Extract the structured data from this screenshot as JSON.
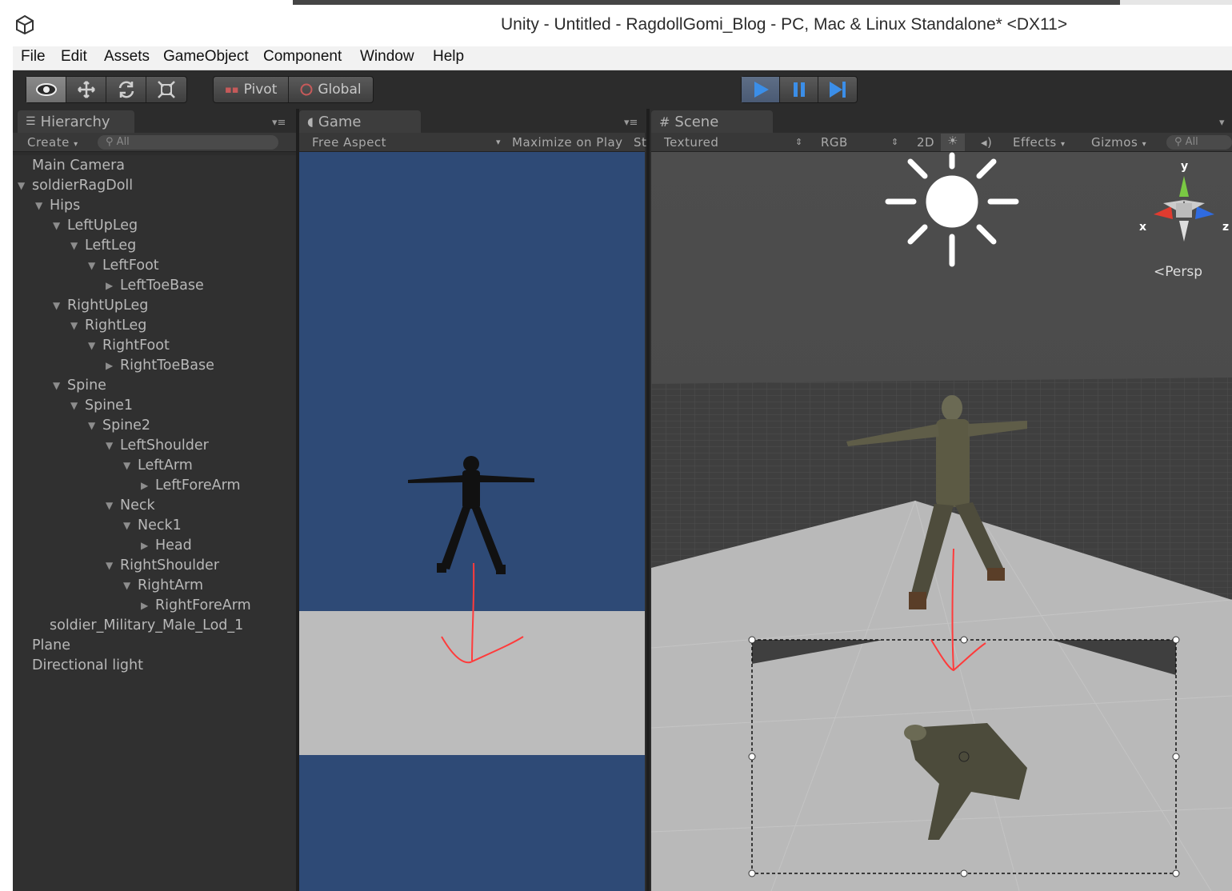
{
  "window": {
    "title": "Unity - Untitled - RagdollGomi_Blog - PC, Mac & Linux Standalone* <DX11>"
  },
  "menu": {
    "items": [
      "File",
      "Edit",
      "Assets",
      "GameObject",
      "Component",
      "Window",
      "Help"
    ]
  },
  "toolbar": {
    "pivot_label": "Pivot",
    "global_label": "Global"
  },
  "hierarchy": {
    "tab_label": "Hierarchy",
    "create_label": "Create",
    "search_placeholder": "All",
    "items": [
      {
        "label": "Main Camera",
        "depth": 0,
        "expander": "none"
      },
      {
        "label": "soldierRagDoll",
        "depth": 0,
        "expander": "open"
      },
      {
        "label": "Hips",
        "depth": 1,
        "expander": "open"
      },
      {
        "label": "LeftUpLeg",
        "depth": 2,
        "expander": "open"
      },
      {
        "label": "LeftLeg",
        "depth": 3,
        "expander": "open"
      },
      {
        "label": "LeftFoot",
        "depth": 4,
        "expander": "open"
      },
      {
        "label": "LeftToeBase",
        "depth": 5,
        "expander": "closed"
      },
      {
        "label": "RightUpLeg",
        "depth": 2,
        "expander": "open"
      },
      {
        "label": "RightLeg",
        "depth": 3,
        "expander": "open"
      },
      {
        "label": "RightFoot",
        "depth": 4,
        "expander": "open"
      },
      {
        "label": "RightToeBase",
        "depth": 5,
        "expander": "closed"
      },
      {
        "label": "Spine",
        "depth": 2,
        "expander": "open"
      },
      {
        "label": "Spine1",
        "depth": 3,
        "expander": "open"
      },
      {
        "label": "Spine2",
        "depth": 4,
        "expander": "open"
      },
      {
        "label": "LeftShoulder",
        "depth": 5,
        "expander": "open"
      },
      {
        "label": "LeftArm",
        "depth": 6,
        "expander": "open"
      },
      {
        "label": "LeftForeArm",
        "depth": 7,
        "expander": "closed"
      },
      {
        "label": "Neck",
        "depth": 5,
        "expander": "open"
      },
      {
        "label": "Neck1",
        "depth": 6,
        "expander": "open"
      },
      {
        "label": "Head",
        "depth": 7,
        "expander": "closed"
      },
      {
        "label": "RightShoulder",
        "depth": 5,
        "expander": "open"
      },
      {
        "label": "RightArm",
        "depth": 6,
        "expander": "open"
      },
      {
        "label": "RightForeArm",
        "depth": 7,
        "expander": "closed"
      },
      {
        "label": "soldier_Military_Male_Lod_1",
        "depth": 1,
        "expander": "none"
      },
      {
        "label": "Plane",
        "depth": 0,
        "expander": "none"
      },
      {
        "label": "Directional light",
        "depth": 0,
        "expander": "none"
      }
    ]
  },
  "game": {
    "tab_label": "Game",
    "aspect_label": "Free Aspect",
    "maximize_label": "Maximize on Play",
    "stats_label": "St"
  },
  "scene": {
    "tab_label": "Scene",
    "render_mode": "Textured",
    "color_mode": "RGB",
    "mode_2d": "2D",
    "effects_label": "Effects",
    "gizmos_label": "Gizmos",
    "search_placeholder": "All",
    "projection_label": "Persp",
    "axis_labels": {
      "y": "y",
      "x": "x",
      "z": "z"
    }
  },
  "colors": {
    "game_sky": "#2e4a76",
    "play_blue": "#3b8ee8",
    "annotation_red": "#ff3b3b"
  }
}
